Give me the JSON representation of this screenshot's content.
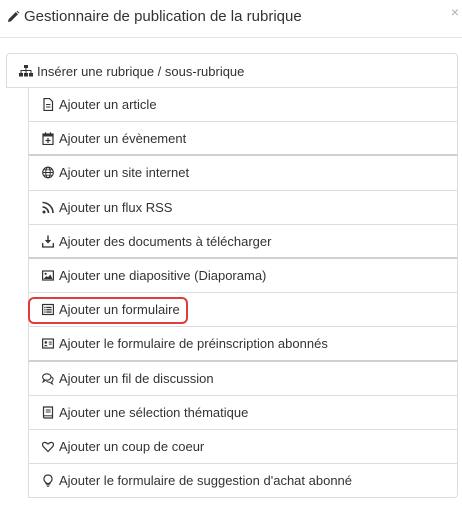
{
  "header": {
    "title": "Gestionnaire de publication de la rubrique",
    "title_icon": "pencil-icon",
    "close_label": "×"
  },
  "root": {
    "label": "Insérer une rubrique / sous-rubrique",
    "icon": "sitemap-icon"
  },
  "items": [
    {
      "label": "Ajouter un article",
      "icon": "file-icon"
    },
    {
      "label": "Ajouter un évènement",
      "icon": "calendar-plus-icon"
    },
    {
      "label": "Ajouter un site internet",
      "icon": "globe-icon"
    },
    {
      "label": "Ajouter un flux RSS",
      "icon": "rss-icon"
    },
    {
      "label": "Ajouter des documents à télécharger",
      "icon": "download-icon"
    },
    {
      "label": "Ajouter une diapositive (Diaporama)",
      "icon": "image-icon"
    },
    {
      "label": "Ajouter un formulaire",
      "icon": "list-alt-icon",
      "highlighted": true
    },
    {
      "label": "Ajouter le formulaire de préinscription abonnés",
      "icon": "id-card-icon"
    },
    {
      "label": "Ajouter un fil de discussion",
      "icon": "comments-icon"
    },
    {
      "label": "Ajouter une sélection thématique",
      "icon": "book-icon"
    },
    {
      "label": "Ajouter un coup de coeur",
      "icon": "heart-icon"
    },
    {
      "label": "Ajouter le formulaire de suggestion d'achat abonné",
      "icon": "lightbulb-icon"
    }
  ],
  "colors": {
    "highlight": "#e03c3c",
    "border": "#dddddd",
    "text": "#333333"
  }
}
